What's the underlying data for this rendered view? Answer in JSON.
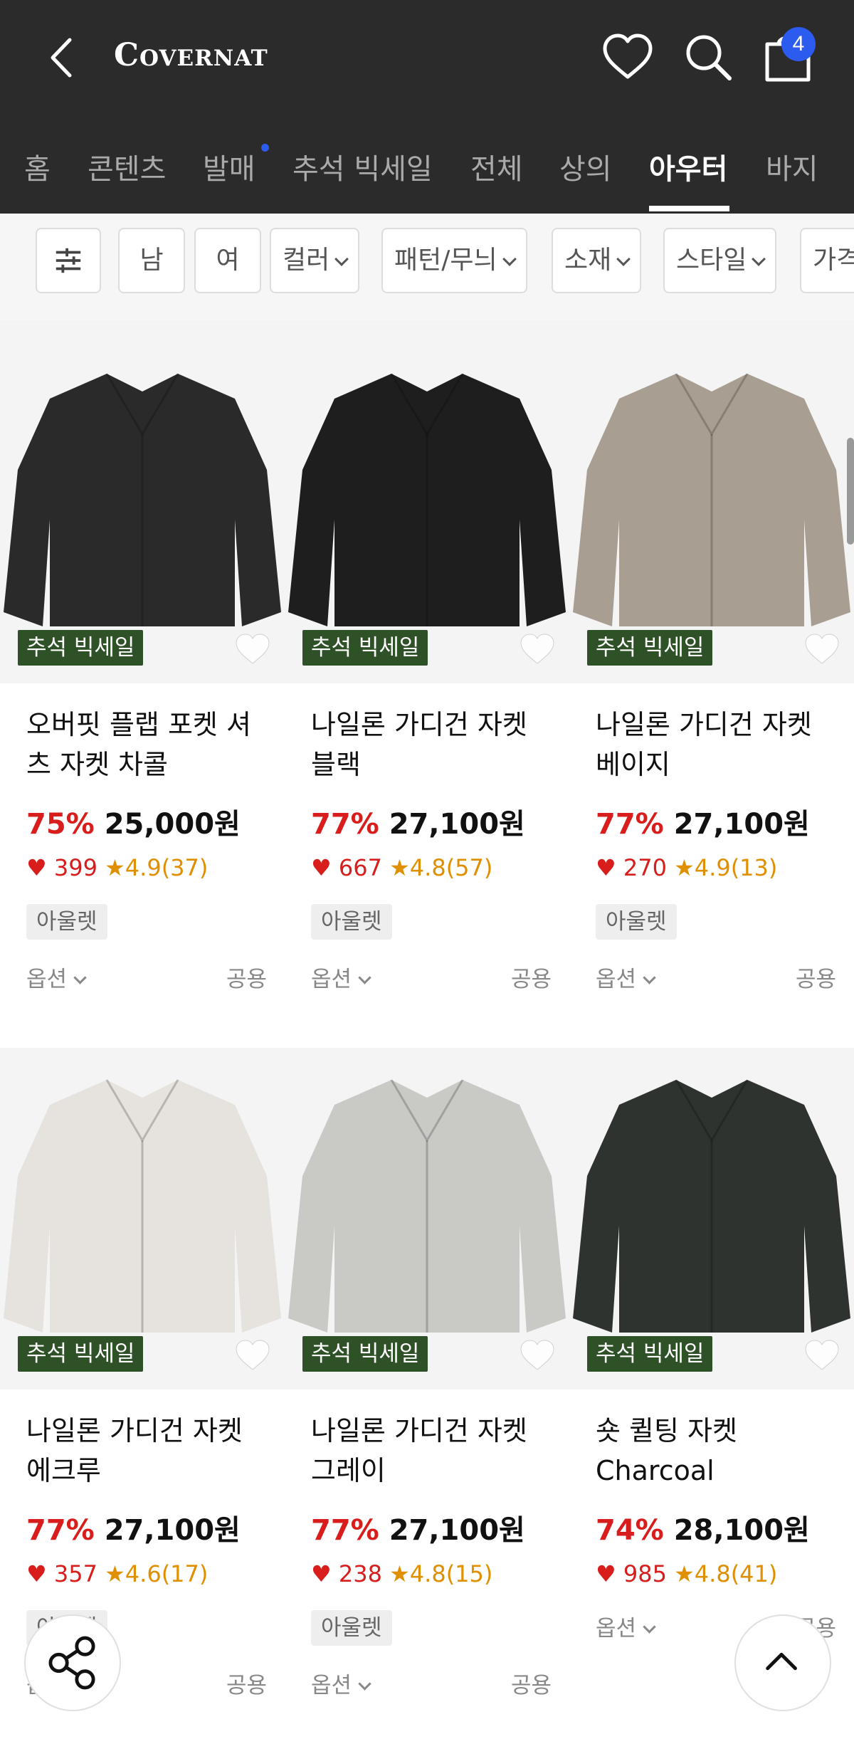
{
  "header": {
    "brand": "Covernat",
    "cart_count": "4"
  },
  "tabs": [
    "홈",
    "콘텐츠",
    "발매",
    "추석 빅세일",
    "전체",
    "상의",
    "아우터",
    "바지"
  ],
  "filters": [
    "남",
    "여",
    "컬러",
    "패턴/무늬",
    "소재",
    "스타일",
    "가격"
  ],
  "products": [
    {
      "name": "오버핏 플랩 포켓 셔츠 자켓 차콜",
      "discount": "75%",
      "price": "25,000원",
      "likes": "399",
      "rating": "4.9(37)",
      "badge": "추석 빅세일",
      "tag": "아울렛",
      "option": "옵션",
      "gender": "공용",
      "color": "#2a2a2a"
    },
    {
      "name": "나일론 가디건 자켓 블랙",
      "discount": "77%",
      "price": "27,100원",
      "likes": "667",
      "rating": "4.8(57)",
      "badge": "추석 빅세일",
      "tag": "아울렛",
      "option": "옵션",
      "gender": "공용",
      "color": "#1e1e1e"
    },
    {
      "name": "나일론 가디건 자켓 베이지",
      "discount": "77%",
      "price": "27,100원",
      "likes": "270",
      "rating": "4.9(13)",
      "badge": "추석 빅세일",
      "tag": "아울렛",
      "option": "옵션",
      "gender": "공용",
      "color": "#a99e92"
    },
    {
      "name": "나일론 가디건 자켓 에크루",
      "discount": "77%",
      "price": "27,100원",
      "likes": "357",
      "rating": "4.6(17)",
      "badge": "추석 빅세일",
      "tag": "아울렛",
      "option": "옵션",
      "gender": "공용",
      "color": "#e6e3de"
    },
    {
      "name": "나일론 가디건 자켓 그레이",
      "discount": "77%",
      "price": "27,100원",
      "likes": "238",
      "rating": "4.8(15)",
      "badge": "추석 빅세일",
      "tag": "아울렛",
      "option": "옵션",
      "gender": "공용",
      "color": "#c9cac6"
    },
    {
      "name": "숏 퀼팅 자켓 Charcoal",
      "discount": "74%",
      "price": "28,100원",
      "likes": "985",
      "rating": "4.8(41)",
      "badge": "추석 빅세일",
      "tag": "",
      "option": "옵션",
      "gender": "공용",
      "color": "#2e332f"
    }
  ],
  "colors": {
    "header_bg": "#2b2b2b",
    "sale_badge": "#2f5127",
    "discount": "#d81d1d",
    "rating": "#e08f00",
    "cart_badge": "#2c5bf0"
  }
}
